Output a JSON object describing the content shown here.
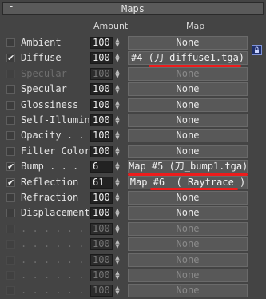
{
  "rollout": {
    "collapse_symbol": "-",
    "title": "Maps"
  },
  "columns": {
    "amount": "Amount",
    "map": "Map"
  },
  "rows": [
    {
      "label": "Ambient",
      "checked": false,
      "enabled": true,
      "amount": "100",
      "map": "None"
    },
    {
      "label": "Diffuse",
      "checked": true,
      "enabled": true,
      "amount": "100",
      "map": "#4 (刀 diffuse1.tga)"
    },
    {
      "label": "Specular",
      "checked": false,
      "enabled": false,
      "amount": "100",
      "map": "None"
    },
    {
      "label": "Specular",
      "checked": false,
      "enabled": true,
      "amount": "100",
      "map": "None"
    },
    {
      "label": "Glossiness",
      "checked": false,
      "enabled": true,
      "amount": "100",
      "map": "None"
    },
    {
      "label": "Self-Illumin",
      "checked": false,
      "enabled": true,
      "amount": "100",
      "map": "None"
    },
    {
      "label": "Opacity . .",
      "checked": false,
      "enabled": true,
      "amount": "100",
      "map": "None"
    },
    {
      "label": "Filter Color",
      "checked": false,
      "enabled": true,
      "amount": "100",
      "map": "None"
    },
    {
      "label": "Bump . . .",
      "checked": true,
      "enabled": true,
      "amount": "6",
      "map": "Map #5 (刀_bump1.tga)"
    },
    {
      "label": "Reflection",
      "checked": true,
      "enabled": true,
      "amount": "61",
      "map": "Map #6  ( Raytrace )"
    },
    {
      "label": "Refraction",
      "checked": false,
      "enabled": true,
      "amount": "100",
      "map": "None"
    },
    {
      "label": "Displacement",
      "checked": false,
      "enabled": true,
      "amount": "100",
      "map": "None"
    },
    {
      "label": ". . . . . .",
      "checked": false,
      "enabled": false,
      "amount": "100",
      "map": "None"
    },
    {
      "label": ". . . . . .",
      "checked": false,
      "enabled": false,
      "amount": "100",
      "map": "None"
    },
    {
      "label": ". . . . . .",
      "checked": false,
      "enabled": false,
      "amount": "100",
      "map": "None"
    },
    {
      "label": ". . . . . .",
      "checked": false,
      "enabled": false,
      "amount": "100",
      "map": "None"
    },
    {
      "label": ". . . . . .",
      "checked": false,
      "enabled": false,
      "amount": "100",
      "map": "None"
    }
  ],
  "icons": {
    "checkmark": "check-icon",
    "spinner": "spinner-arrows-icon",
    "lock": "lock-icon"
  },
  "colors": {
    "annotation_underline": "#ee1c1c",
    "lock_button": "#1f2f6c"
  }
}
